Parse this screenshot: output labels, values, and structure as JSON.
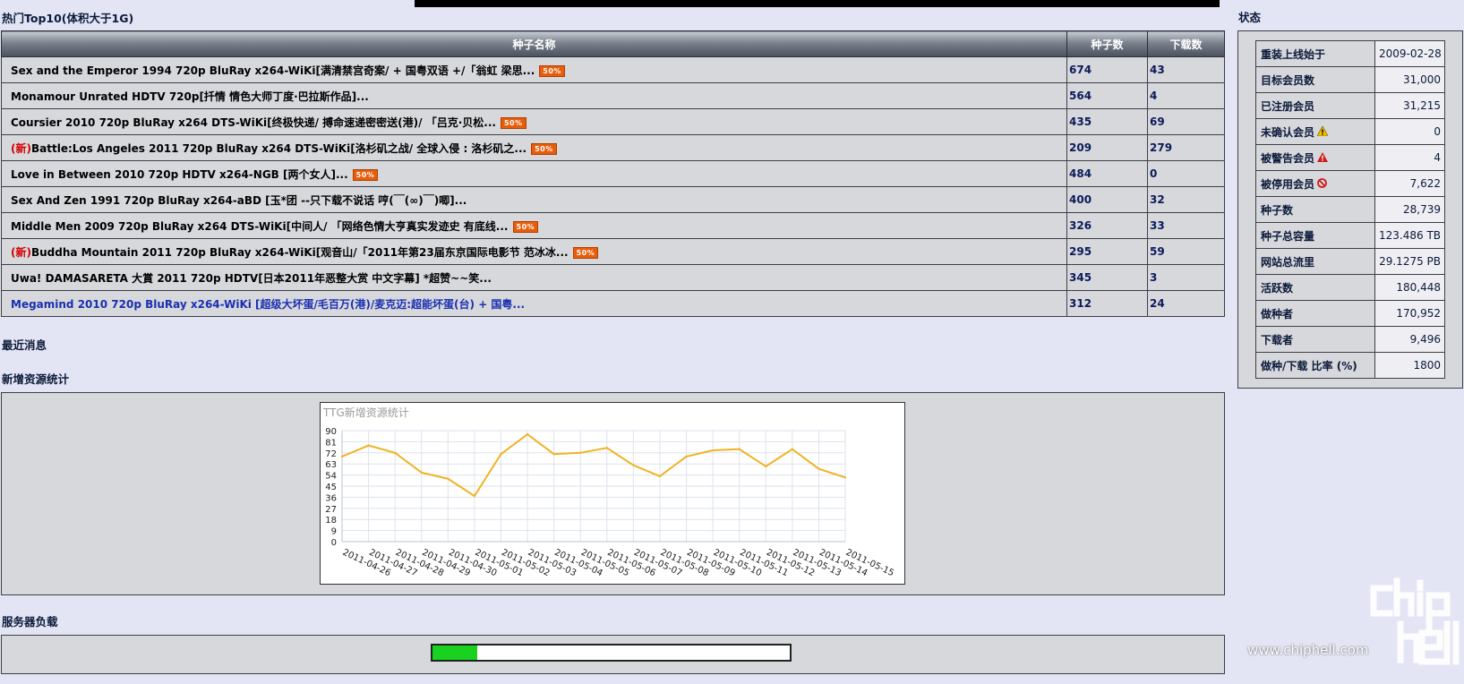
{
  "top10": {
    "title": "热门Top10(体积大于1G)",
    "headers": {
      "name": "种子名称",
      "seeders": "种子数",
      "leechers": "下载数"
    },
    "rows": [
      {
        "new": "",
        "name": "Sex and the Emperor 1994 720p BluRay x264-WiKi[满清禁宫奇案/ + 国粤双语 +/「翁虹 梁思...",
        "badge": "50%",
        "seeders": "674",
        "leechers": "43"
      },
      {
        "new": "",
        "name": "Monamour Unrated HDTV 720p[扦情 情色大师丁度·巴拉斯作品]...",
        "badge": "",
        "seeders": "564",
        "leechers": "4"
      },
      {
        "new": "",
        "name": "Coursier 2010 720p BluRay x264 DTS-WiKi[终极快递/ 搏命速递密密送(港)/ 「吕克·贝松...",
        "badge": "50%",
        "seeders": "435",
        "leechers": "69"
      },
      {
        "new": "(新)",
        "name": "Battle:Los Angeles 2011 720p BluRay x264 DTS-WiKi[洛杉矶之战/ 全球入侵 : 洛杉矶之...",
        "badge": "50%",
        "seeders": "209",
        "leechers": "279"
      },
      {
        "new": "",
        "name": "Love in Between 2010 720p HDTV x264-NGB [两个女人]...",
        "badge": "50%",
        "seeders": "484",
        "leechers": "0"
      },
      {
        "new": "",
        "name": "Sex And Zen 1991 720p BluRay x264-aBD [玉*团 --只下载不说话 哼(￣(∞)￣)唧]...",
        "badge": "",
        "seeders": "400",
        "leechers": "32"
      },
      {
        "new": "",
        "name": "Middle Men 2009 720p BluRay x264 DTS-WiKi[中间人/ 「网络色情大亨真实发迹史 有底线...",
        "badge": "50%",
        "seeders": "326",
        "leechers": "33"
      },
      {
        "new": "(新)",
        "name": "Buddha Mountain 2011 720p BluRay x264-WiKi[观音山/「2011年第23届东京国际电影节 范冰冰...",
        "badge": "50%",
        "seeders": "295",
        "leechers": "59"
      },
      {
        "new": "",
        "name": "Uwa! DAMASARETA 大賞 2011 720p HDTV[日本2011年恶整大赏 中文字幕] *超赞~~笑...",
        "badge": "",
        "seeders": "345",
        "leechers": "3"
      },
      {
        "new": "",
        "name": "Megamind 2010 720p BluRay x264-WiKi [超级大坏蛋/毛百万(港)/麦克迈:超能坏蛋(台) + 国粤...",
        "badge": "",
        "seeders": "312",
        "leechers": "24",
        "link": true
      }
    ]
  },
  "news": {
    "title": "最近消息"
  },
  "stats": {
    "title": "新增资源统计"
  },
  "chart_data": {
    "type": "line",
    "title": "TTG新增资源统计",
    "categories": [
      "2011-04-26",
      "2011-04-27",
      "2011-04-28",
      "2011-04-29",
      "2011-04-30",
      "2011-05-01",
      "2011-05-02",
      "2011-05-03",
      "2011-05-04",
      "2011-05-05",
      "2011-05-06",
      "2011-05-07",
      "2011-05-08",
      "2011-05-09",
      "2011-05-10",
      "2011-05-11",
      "2011-05-12",
      "2011-05-13",
      "2011-05-14",
      "2011-05-15"
    ],
    "values": [
      69,
      78,
      72,
      56,
      51,
      37,
      71,
      87,
      71,
      72,
      76,
      62,
      53,
      69,
      74,
      75,
      61,
      75,
      59,
      52
    ],
    "yticks": [
      0,
      9,
      18,
      27,
      36,
      45,
      54,
      63,
      72,
      81,
      90
    ],
    "ylim": [
      0,
      90
    ],
    "grid": true,
    "color": "#f0b323"
  },
  "server": {
    "title": "服务器负载",
    "load_fraction": 0.125
  },
  "status": {
    "title": "状态",
    "rows": [
      {
        "key": "重装上线始于",
        "value": "2009-02-28",
        "icon": ""
      },
      {
        "key": "目标会员数",
        "value": "31,000",
        "icon": ""
      },
      {
        "key": "已注册会员",
        "value": "31,215",
        "icon": ""
      },
      {
        "key": "未确认会员",
        "value": "0",
        "icon": "warning-icon"
      },
      {
        "key": "被警告会员",
        "value": "4",
        "icon": "alert-icon"
      },
      {
        "key": "被停用会员",
        "value": "7,622",
        "icon": "disabled-icon"
      },
      {
        "key": "种子数",
        "value": "28,739",
        "icon": ""
      },
      {
        "key": "种子总容量",
        "value": "123.486 TB",
        "icon": ""
      },
      {
        "key": "网站总流里",
        "value": "29.1275 PB",
        "icon": ""
      },
      {
        "key": "活跃数",
        "value": "180,448",
        "icon": ""
      },
      {
        "key": "做种者",
        "value": "170,952",
        "icon": ""
      },
      {
        "key": "下载者",
        "value": "9,496",
        "icon": ""
      },
      {
        "key": "做种/下载 比率 (%)",
        "value": "1800",
        "icon": ""
      }
    ]
  },
  "watermark": {
    "text": "www.chiphell.com",
    "logo": "chip hell"
  }
}
